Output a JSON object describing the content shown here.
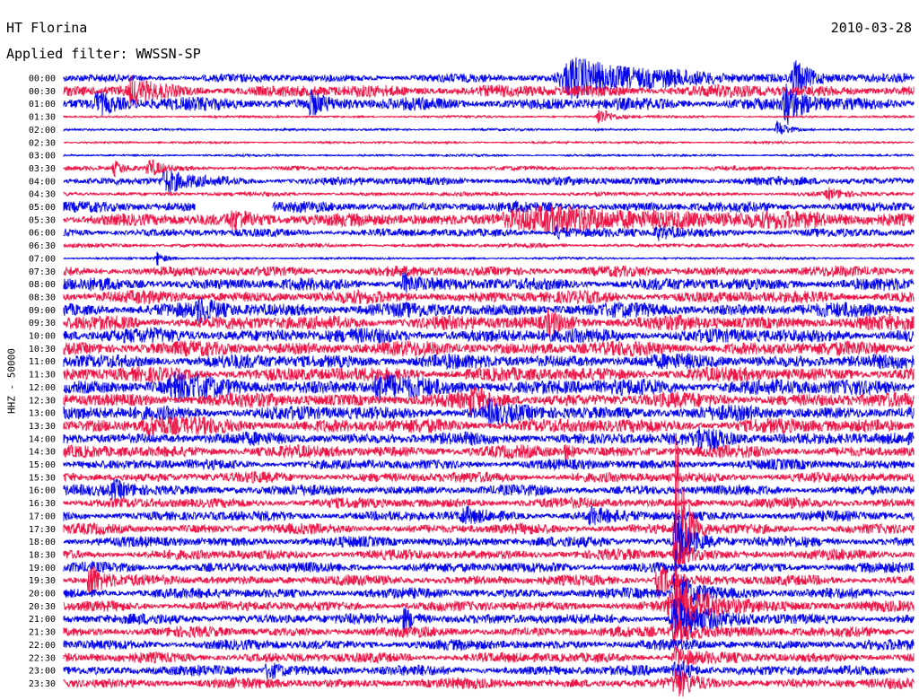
{
  "header": {
    "station": "HT Florina",
    "date": "2010-03-28",
    "filter_label": "Applied filter:",
    "filter_value": "WWSSN-SP"
  },
  "chart_data": {
    "type": "line",
    "ylabel": "HHZ - 50000",
    "row_labels": [
      "00:00",
      "00:30",
      "01:00",
      "01:30",
      "02:00",
      "02:30",
      "03:00",
      "03:30",
      "04:00",
      "04:30",
      "05:00",
      "05:30",
      "06:00",
      "06:30",
      "07:00",
      "07:30",
      "08:00",
      "08:30",
      "09:00",
      "09:30",
      "10:00",
      "10:30",
      "11:00",
      "11:30",
      "12:00",
      "12:30",
      "13:00",
      "13:30",
      "14:00",
      "14:30",
      "15:00",
      "15:30",
      "16:00",
      "16:30",
      "17:00",
      "17:30",
      "18:00",
      "18:30",
      "19:00",
      "19:30",
      "20:00",
      "20:30",
      "21:00",
      "21:30",
      "22:00",
      "22:30",
      "23:00",
      "23:30"
    ],
    "series_colors": [
      "#0000ee",
      "#ee1144"
    ],
    "grid": false,
    "row_noise_level": [
      4,
      6,
      6,
      1,
      1,
      1,
      1,
      2,
      4,
      2,
      5,
      6,
      4,
      2,
      1,
      5,
      6,
      6,
      7,
      7,
      7,
      7,
      7,
      7,
      8,
      7,
      7,
      7,
      6,
      6,
      5,
      5,
      5,
      5,
      5,
      5,
      5,
      5,
      5,
      5,
      5,
      5,
      5,
      5,
      5,
      5,
      5,
      5
    ],
    "events": [
      {
        "row": 0,
        "at": 0.6,
        "width": 0.1,
        "amp": 22
      },
      {
        "row": 0,
        "at": 0.86,
        "width": 0.02,
        "amp": 20
      },
      {
        "row": 1,
        "at": 0.08,
        "width": 0.02,
        "amp": 12
      },
      {
        "row": 2,
        "at": 0.04,
        "width": 0.03,
        "amp": 10
      },
      {
        "row": 2,
        "at": 0.29,
        "width": 0.02,
        "amp": 12
      },
      {
        "row": 2,
        "at": 0.85,
        "width": 0.02,
        "amp": 22
      },
      {
        "row": 3,
        "at": 0.63,
        "width": 0.02,
        "amp": 10
      },
      {
        "row": 4,
        "at": 0.84,
        "width": 0.015,
        "amp": 10
      },
      {
        "row": 7,
        "at": 0.06,
        "width": 0.015,
        "amp": 8
      },
      {
        "row": 7,
        "at": 0.1,
        "width": 0.02,
        "amp": 10
      },
      {
        "row": 8,
        "at": 0.12,
        "width": 0.03,
        "amp": 12
      },
      {
        "row": 9,
        "at": 0.9,
        "width": 0.02,
        "amp": 6
      },
      {
        "row": 11,
        "at": 0.2,
        "width": 0.04,
        "amp": 8
      },
      {
        "row": 11,
        "at": 0.55,
        "width": 0.3,
        "amp": 10
      },
      {
        "row": 12,
        "at": 0.58,
        "width": 0.02,
        "amp": 7
      },
      {
        "row": 12,
        "at": 0.7,
        "width": 0.03,
        "amp": 6
      },
      {
        "row": 14,
        "at": 0.11,
        "width": 0.01,
        "amp": 8
      },
      {
        "row": 16,
        "at": 0.4,
        "width": 0.02,
        "amp": 10
      },
      {
        "row": 18,
        "at": 0.16,
        "width": 0.02,
        "amp": 10
      },
      {
        "row": 19,
        "at": 0.57,
        "width": 0.02,
        "amp": 10
      },
      {
        "row": 24,
        "at": 0.13,
        "width": 0.04,
        "amp": 10
      },
      {
        "row": 24,
        "at": 0.37,
        "width": 0.03,
        "amp": 12
      },
      {
        "row": 25,
        "at": 0.48,
        "width": 0.02,
        "amp": 10
      },
      {
        "row": 26,
        "at": 0.5,
        "width": 0.02,
        "amp": 9
      },
      {
        "row": 27,
        "at": 0.1,
        "width": 0.04,
        "amp": 8
      },
      {
        "row": 28,
        "at": 0.75,
        "width": 0.04,
        "amp": 10
      },
      {
        "row": 29,
        "at": 0.59,
        "width": 0.01,
        "amp": 8
      },
      {
        "row": 32,
        "at": 0.06,
        "width": 0.03,
        "amp": 8
      },
      {
        "row": 34,
        "at": 0.47,
        "width": 0.02,
        "amp": 8
      },
      {
        "row": 34,
        "at": 0.62,
        "width": 0.02,
        "amp": 8
      },
      {
        "row": 35,
        "at": 0.72,
        "width": 0.012,
        "amp": 120
      },
      {
        "row": 36,
        "at": 0.72,
        "width": 0.02,
        "amp": 30
      },
      {
        "row": 37,
        "at": 0.72,
        "width": 0.02,
        "amp": 14
      },
      {
        "row": 39,
        "at": 0.03,
        "width": 0.015,
        "amp": 22
      },
      {
        "row": 39,
        "at": 0.7,
        "width": 0.02,
        "amp": 18
      },
      {
        "row": 40,
        "at": 0.72,
        "width": 0.03,
        "amp": 24
      },
      {
        "row": 41,
        "at": 0.72,
        "width": 0.05,
        "amp": 28
      },
      {
        "row": 42,
        "at": 0.4,
        "width": 0.02,
        "amp": 12
      },
      {
        "row": 42,
        "at": 0.72,
        "width": 0.04,
        "amp": 22
      },
      {
        "row": 43,
        "at": 0.72,
        "width": 0.04,
        "amp": 12
      },
      {
        "row": 45,
        "at": 0.72,
        "width": 0.02,
        "amp": 12
      },
      {
        "row": 46,
        "at": 0.24,
        "width": 0.02,
        "amp": 10
      },
      {
        "row": 46,
        "at": 0.72,
        "width": 0.02,
        "amp": 14
      },
      {
        "row": 47,
        "at": 0.72,
        "width": 0.02,
        "amp": 14
      }
    ],
    "gaps": [
      {
        "row": 10,
        "from": 0.155,
        "to": 0.245
      }
    ]
  }
}
